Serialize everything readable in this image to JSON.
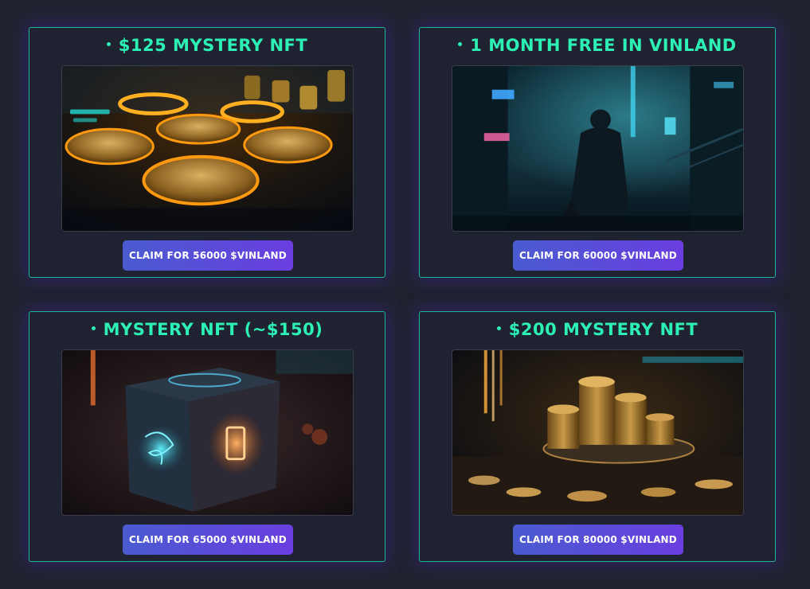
{
  "cards": [
    {
      "title": "$125 MYSTERY NFT",
      "image": "golden-coins-illustration",
      "button_label": "CLAIM FOR 56000 $VINLAND"
    },
    {
      "title": "1 MONTH FREE IN VINLAND",
      "image": "cyberpunk-city-figure-illustration",
      "button_label": "CLAIM FOR 60000 $VINLAND"
    },
    {
      "title": "MYSTERY NFT (~$150)",
      "image": "glowing-mystery-cube-illustration",
      "button_label": "CLAIM FOR 65000 $VINLAND"
    },
    {
      "title": "$200 MYSTERY NFT",
      "image": "stacked-coins-illustration",
      "button_label": "CLAIM FOR 80000 $VINLAND"
    }
  ],
  "colors": {
    "background": "#20222f",
    "card_border": "#1fb59a",
    "title": "#2cf0b4",
    "button_start": "#4a5bd0",
    "button_end": "#6a3ee0"
  }
}
